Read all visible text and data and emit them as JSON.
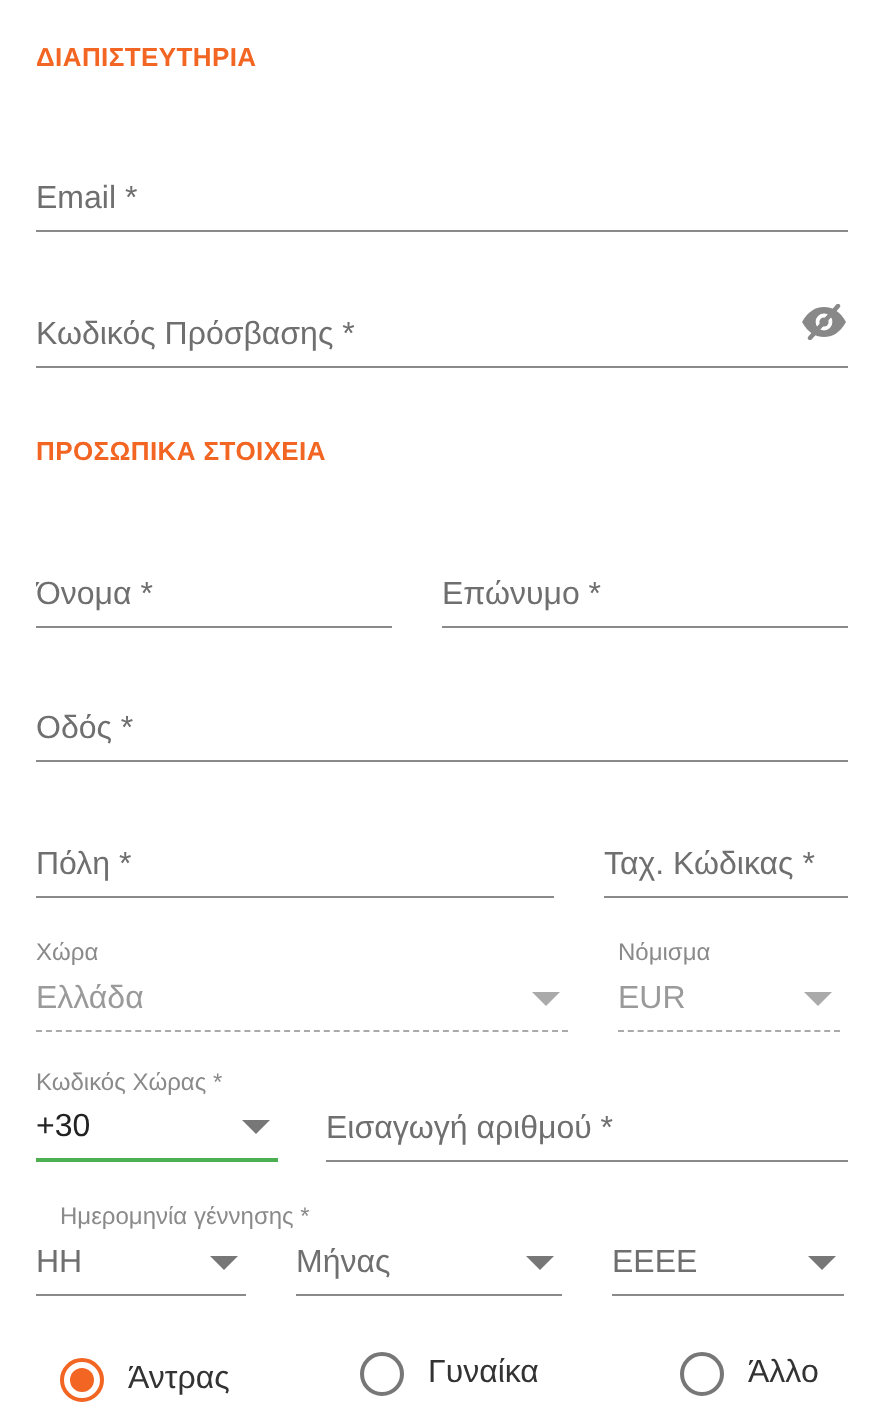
{
  "credentials": {
    "heading": "ΔΙΑΠΙΣΤΕΥΤΗΡΙΑ",
    "email": {
      "placeholder": "Email *"
    },
    "password": {
      "placeholder": "Κωδικός Πρόσβασης *",
      "visible": false
    }
  },
  "personal": {
    "heading": "ΠΡΟΣΩΠΙΚΑ ΣΤΟΙΧΕΙΑ",
    "first_name": {
      "placeholder": "Όνομα *"
    },
    "last_name": {
      "placeholder": "Επώνυμο *"
    },
    "street": {
      "placeholder": "Οδός *"
    },
    "city": {
      "placeholder": "Πόλη *"
    },
    "postal_code": {
      "placeholder": "Ταχ. Κώδικας *"
    },
    "country": {
      "label": "Χώρα",
      "value": "Ελλάδα",
      "disabled": true
    },
    "currency": {
      "label": "Νόμισμα",
      "value": "EUR",
      "disabled": true
    },
    "country_code": {
      "label": "Κωδικός Χώρας *",
      "value": "+30",
      "focused": true
    },
    "phone": {
      "placeholder": "Εισαγωγή αριθμού *"
    },
    "birth_date": {
      "label": "Ημερομηνία γέννησης *",
      "day": {
        "placeholder": "ΗΗ"
      },
      "month": {
        "placeholder": "Μήνας"
      },
      "year": {
        "placeholder": "ΕΕΕΕ"
      }
    },
    "gender": [
      {
        "label": "Άντρας",
        "selected": true
      },
      {
        "label": "Γυναίκα",
        "selected": false
      },
      {
        "label": "Άλλο",
        "selected": false
      }
    ]
  }
}
